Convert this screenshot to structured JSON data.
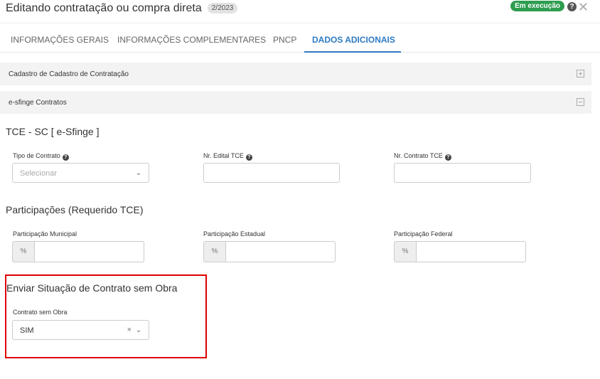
{
  "header": {
    "title": "Editando contratação ou compra direta",
    "code": "2/2023",
    "status": "Em execução",
    "help_icon": "question-circle-icon",
    "close_icon": "close-icon"
  },
  "tabs": [
    {
      "label": "INFORMAÇÕES GERAIS",
      "active": false
    },
    {
      "label": "INFORMAÇÕES COMPLEMENTARES",
      "active": false
    },
    {
      "label": "PNCP",
      "active": false
    },
    {
      "label": "DADOS ADICIONAIS",
      "active": true
    }
  ],
  "panels": [
    {
      "title": "Cadastro de Cadastro de Contratação",
      "state": "collapsed",
      "icon": "expand-icon"
    },
    {
      "title": "e-sfinge Contratos",
      "state": "expanded",
      "icon": "collapse-icon"
    }
  ],
  "tce_section": {
    "title": "TCE - SC [ e-Sfinge ]",
    "tipo_contrato": {
      "label": "Tipo de Contrato",
      "placeholder": "Selecionar"
    },
    "nr_edital": {
      "label": "Nr. Edital TCE",
      "value": ""
    },
    "nr_contrato": {
      "label": "Nr. Contrato TCE",
      "value": ""
    }
  },
  "participacoes": {
    "title": "Participações (Requerido TCE)",
    "addon": "%",
    "municipal": {
      "label": "Participação Municipal",
      "value": ""
    },
    "estadual": {
      "label": "Participação Estadual",
      "value": ""
    },
    "federal": {
      "label": "Participação Federal",
      "value": ""
    }
  },
  "situacao": {
    "title": "Enviar Situação de Contrato sem Obra",
    "field_label": "Contrato sem Obra",
    "value": "SIM"
  },
  "colors": {
    "accent": "#2d7bc4",
    "status": "#2e9d4f",
    "highlight": "#e00000"
  }
}
